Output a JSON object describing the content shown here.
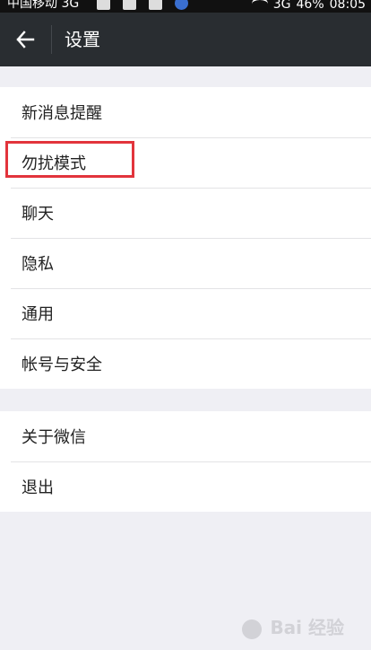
{
  "status_bar": {
    "carrier": "中国移动 3G",
    "network": "3G",
    "battery": "46%",
    "time": "08:05"
  },
  "header": {
    "back_icon": "arrow-left-icon",
    "title": "设置"
  },
  "groups": [
    {
      "items": [
        {
          "label": "新消息提醒"
        },
        {
          "label": "勿扰模式",
          "highlighted": true
        },
        {
          "label": "聊天"
        },
        {
          "label": "隐私"
        },
        {
          "label": "通用"
        },
        {
          "label": "帐号与安全"
        }
      ]
    },
    {
      "items": [
        {
          "label": "关于微信"
        },
        {
          "label": "退出"
        }
      ]
    }
  ],
  "annotation": {
    "color": "#e2343c"
  },
  "watermark": {
    "text": "Bai 经验"
  },
  "colors": {
    "app_bar": "#292d31",
    "background": "#efeff4"
  }
}
